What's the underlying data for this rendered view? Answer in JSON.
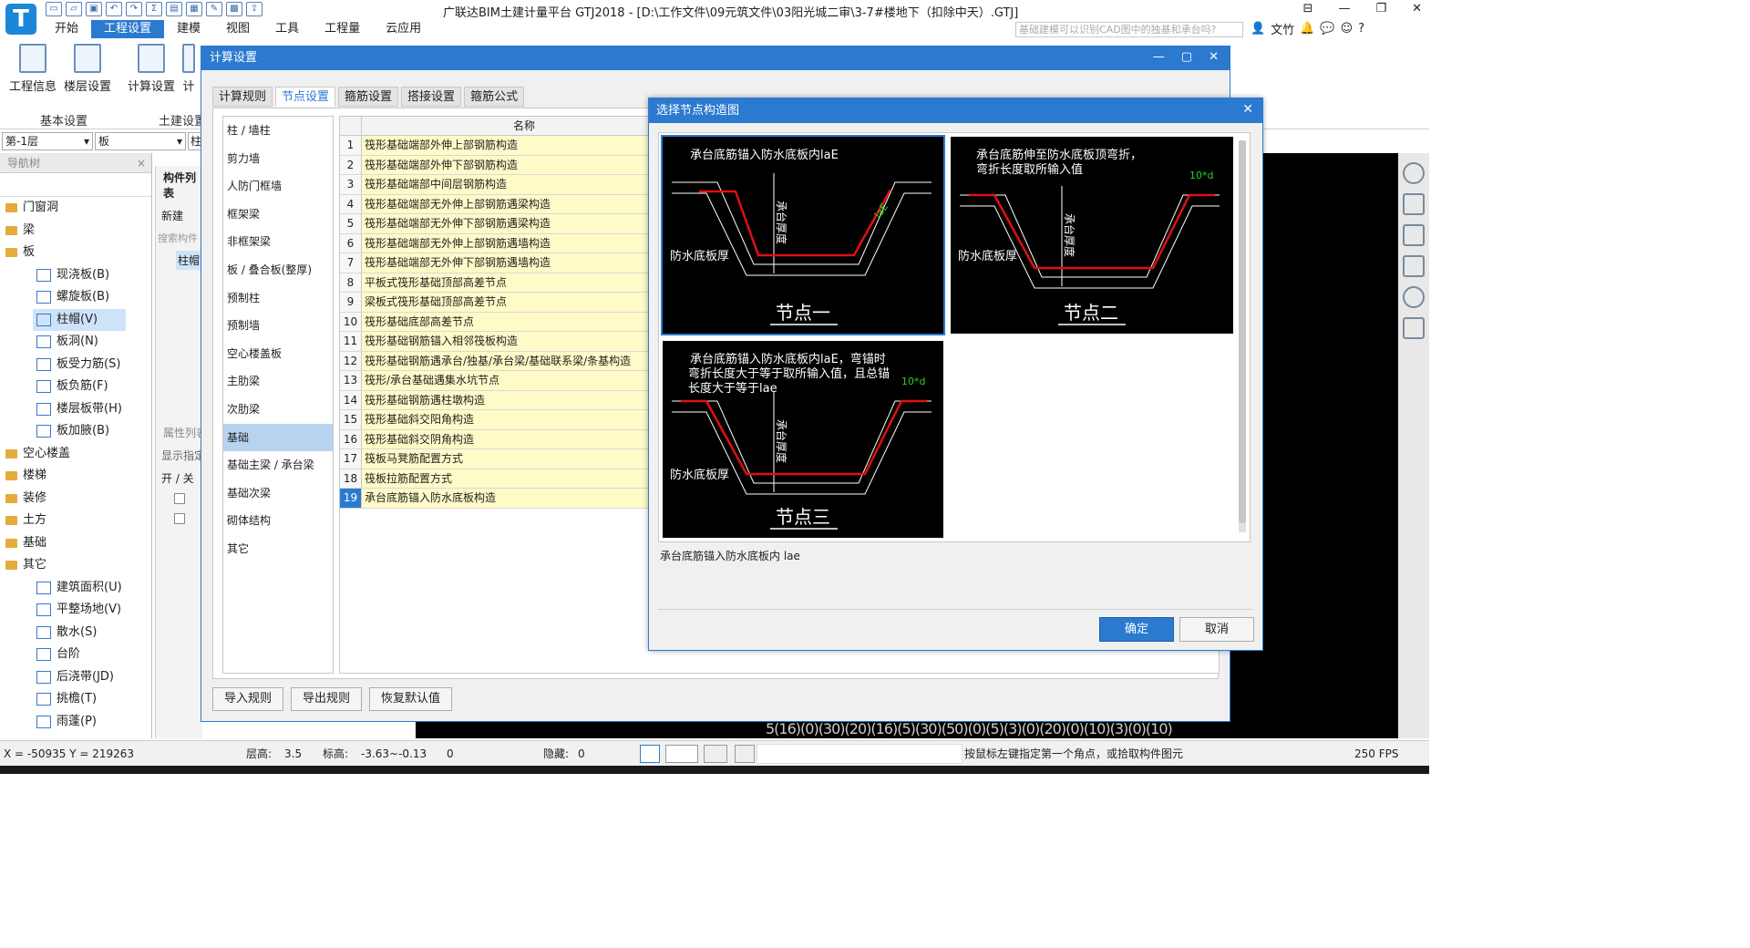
{
  "app": {
    "title": "广联达BIM土建计量平台 GTJ2018 - [D:\\工作文件\\09元筑文件\\03阳光城二审\\3-7#楼地下（扣除中天）.GTJ]",
    "logo_letter": "T",
    "window_controls": [
      "⊟",
      "—",
      "❐",
      "✕"
    ],
    "search_placeholder": "基础建模可以识别CAD图中的独基和承台吗?",
    "user_name": "文竹"
  },
  "menu": [
    "开始",
    "工程设置",
    "建模",
    "视图",
    "工具",
    "工程量",
    "云应用"
  ],
  "menu_active": "工程设置",
  "ribbon": {
    "buttons": [
      "工程信息",
      "楼层设置",
      "计算设置",
      "计"
    ],
    "groups": [
      "基本设置",
      "土建设置"
    ]
  },
  "selectors": {
    "floor": "第-1层",
    "type": "板",
    "type2": "柱"
  },
  "nav": {
    "title": "导航树",
    "items": [
      {
        "label": "门窗洞",
        "level": 0
      },
      {
        "label": "梁",
        "level": 0
      },
      {
        "label": "板",
        "level": 0
      },
      {
        "label": "现浇板(B)",
        "level": 1
      },
      {
        "label": "螺旋板(B)",
        "level": 1
      },
      {
        "label": "柱帽(V)",
        "level": 1,
        "selected": true
      },
      {
        "label": "板洞(N)",
        "level": 1
      },
      {
        "label": "板受力筋(S)",
        "level": 1
      },
      {
        "label": "板负筋(F)",
        "level": 1
      },
      {
        "label": "楼层板带(H)",
        "level": 1
      },
      {
        "label": "板加腋(B)",
        "level": 1
      },
      {
        "label": "空心楼盖",
        "level": 0
      },
      {
        "label": "楼梯",
        "level": 0
      },
      {
        "label": "装修",
        "level": 0
      },
      {
        "label": "土方",
        "level": 0
      },
      {
        "label": "基础",
        "level": 0
      },
      {
        "label": "其它",
        "level": 0
      },
      {
        "label": "建筑面积(U)",
        "level": 1
      },
      {
        "label": "平整场地(V)",
        "level": 1
      },
      {
        "label": "散水(S)",
        "level": 1
      },
      {
        "label": "台阶",
        "level": 1
      },
      {
        "label": "后浇带(JD)",
        "level": 1
      },
      {
        "label": "挑檐(T)",
        "level": 1
      },
      {
        "label": "雨蓬(P)",
        "level": 1
      }
    ]
  },
  "mid_panel": {
    "title": "构件列表",
    "new_label": "新建",
    "search": "搜索构件",
    "item": "柱帽",
    "props_title": "属性列表",
    "display": "显示指定",
    "onoff": "开 / 关"
  },
  "dialog1": {
    "title": "计算设置",
    "controls": [
      "—",
      "▢",
      "✕"
    ],
    "tabs": [
      "计算规则",
      "节点设置",
      "箍筋设置",
      "搭接设置",
      "箍筋公式"
    ],
    "active_tab": "节点设置",
    "categories": [
      "柱 / 墙柱",
      "剪力墙",
      "人防门框墙",
      "框架梁",
      "非框架梁",
      "板 / 叠合板(整厚)",
      "预制柱",
      "预制墙",
      "空心楼盖板",
      "主肋梁",
      "次肋梁",
      "基础",
      "基础主梁 / 承台梁",
      "基础次梁",
      "砌体结构",
      "其它"
    ],
    "selected_category": "基础",
    "grid_header": "名称",
    "rows": [
      "筏形基础端部外伸上部钢筋构造",
      "筏形基础端部外伸下部钢筋构造",
      "筏形基础端部中间层钢筋构造",
      "筏形基础端部无外伸上部钢筋遇梁构造",
      "筏形基础端部无外伸下部钢筋遇梁构造",
      "筏形基础端部无外伸上部钢筋遇墙构造",
      "筏形基础端部无外伸下部钢筋遇墙构造",
      "平板式筏形基础顶部高差节点",
      "梁板式筏形基础顶部高差节点",
      "筏形基础底部高差节点",
      "筏形基础钢筋锚入相邻筏板构造",
      "筏形基础钢筋遇承台/独基/承台梁/基础联系梁/条基构造",
      "筏形/承台基础遇集水坑节点",
      "筏形基础钢筋遇柱墩构造",
      "筏形基础斜交阳角构造",
      "筏形基础斜交阴角构造",
      "筏板马凳筋配置方式",
      "筏板拉筋配置方式",
      "承台底筋锚入防水底板构造"
    ],
    "selected_row": 19,
    "buttons": [
      "导入规则",
      "导出规则",
      "恢复默认值"
    ]
  },
  "dialog2": {
    "title": "选择节点构造图",
    "close": "✕",
    "nodes": [
      {
        "title": "节点一",
        "desc1": "承台底筋锚入防水底板内laE",
        "desc2": "",
        "desc3": "",
        "thick": "承台厚度",
        "base": "防水底板厚",
        "anchor": "laE"
      },
      {
        "title": "节点二",
        "desc1": "承台底筋伸至防水底板顶弯折，",
        "desc2": "弯折长度取所输入值",
        "desc3": "",
        "thick": "承台厚度",
        "base": "防水底板厚",
        "anchor": "10*d"
      },
      {
        "title": "节点三",
        "desc1": "承台底筋锚入防水底板内laE，弯锚时",
        "desc2": "弯折长度大于等于取所输入值，且总锚",
        "desc3": "长度大于等于lae",
        "thick": "承台厚度",
        "base": "防水底板厚",
        "anchor": "10*d"
      }
    ],
    "caption": "承台底筋锚入防水底板内 lae",
    "ok": "确定",
    "cancel": "取消"
  },
  "canvas_text": "5(16)(0)(30)(20)(16)(5)(30)(50)(0)(5)(3)(0)(20)(0)(10)(3)(0)(10)",
  "status": {
    "coords": "X = -50935 Y = 219263",
    "floor_height_label": "层高:",
    "floor_height": "3.5",
    "elev_label": "标高:",
    "elev": "-3.63~-0.13",
    "zero": "0",
    "hidden_label": "隐藏:",
    "hidden": "0",
    "hint": "按鼠标左键指定第一个角点，或拾取构件图元",
    "fps": "250 FPS"
  },
  "colors": {
    "accent": "#2b7ad0",
    "row_bg": "#fffbc8",
    "rebar": "#e01010",
    "label_green": "#26d626"
  }
}
